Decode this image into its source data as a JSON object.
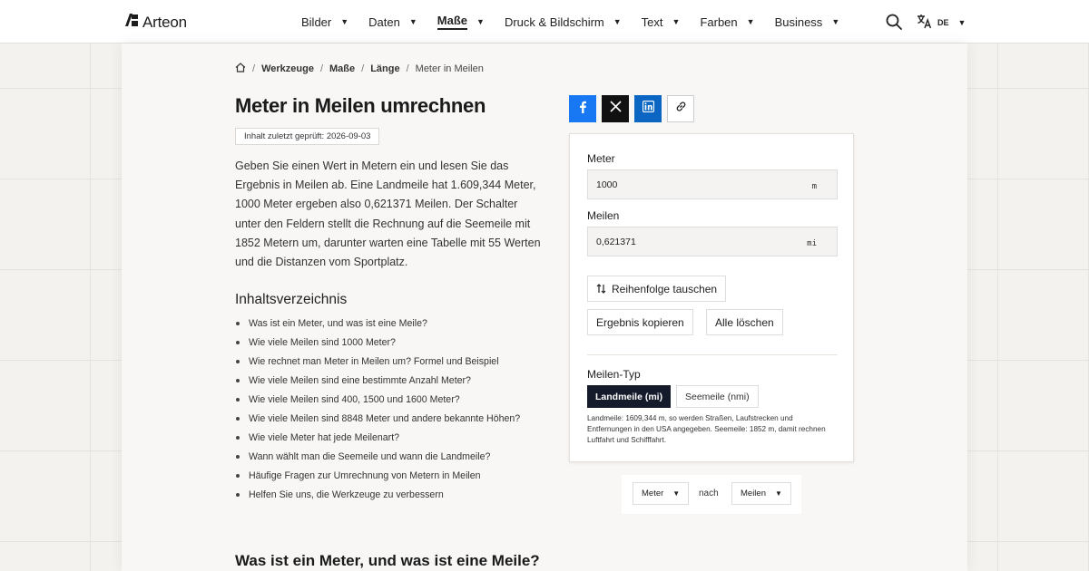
{
  "brand": {
    "name": "Arteon"
  },
  "nav": {
    "items": [
      {
        "label": "Bilder",
        "active": false
      },
      {
        "label": "Daten",
        "active": false
      },
      {
        "label": "Maße",
        "active": true
      },
      {
        "label": "Druck & Bildschirm",
        "active": false
      },
      {
        "label": "Text",
        "active": false
      },
      {
        "label": "Farben",
        "active": false
      },
      {
        "label": "Business",
        "active": false
      }
    ],
    "language": "DE",
    "icons": {
      "search": "search-icon",
      "language": "translate-icon",
      "caret": "caret-down-icon"
    }
  },
  "breadcrumb": {
    "home_icon": "home-icon",
    "items": [
      "Werkzeuge",
      "Maße",
      "Länge"
    ],
    "current": "Meter in Meilen"
  },
  "page": {
    "title": "Meter in Meilen umrechnen",
    "checked": "Inhalt zuletzt geprüft: 2026-09-03",
    "intro": "Geben Sie einen Wert in Metern ein und lesen Sie das Ergebnis in Meilen ab. Eine Landmeile hat 1.609,344 Meter, 1000 Meter ergeben also 0,621371 Meilen. Der Schalter unter den Feldern stellt die Rechnung auf die Seemeile mit 1852 Metern um, darunter warten eine Tabelle mit 55 Werten und die Distanzen vom Sportplatz.",
    "toc_title": "Inhaltsverzeichnis",
    "toc": [
      "Was ist ein Meter, und was ist eine Meile?",
      "Wie viele Meilen sind 1000 Meter?",
      "Wie rechnet man Meter in Meilen um? Formel und Beispiel",
      "Wie viele Meilen sind eine bestimmte Anzahl Meter?",
      "Wie viele Meilen sind 400, 1500 und 1600 Meter?",
      "Wie viele Meilen sind 8848 Meter und andere bekannte Höhen?",
      "Wie viele Meter hat jede Meilenart?",
      "Wann wählt man die Seemeile und wann die Landmeile?",
      "Häufige Fragen zur Umrechnung von Metern in Meilen",
      "Helfen Sie uns, die Werkzeuge zu verbessern"
    ],
    "section_heading": "Was ist ein Meter, und was ist eine Meile?"
  },
  "share": {
    "icons": [
      "facebook-icon",
      "x-icon",
      "linkedin-icon",
      "link-icon"
    ],
    "colors": {
      "facebook": "#1877f2",
      "x": "#111111",
      "linkedin": "#0a66c2"
    }
  },
  "converter": {
    "from": {
      "label": "Meter",
      "value": "1000",
      "unit": "m"
    },
    "to": {
      "label": "Meilen",
      "value": "0,621371",
      "unit": "mi"
    },
    "swap_label": "Reihenfolge tauschen",
    "swap_icon": "swap-vertical-icon",
    "copy_label": "Ergebnis kopieren",
    "clear_label": "Alle löschen",
    "type_label": "Meilen-Typ",
    "type_options": [
      "Landmeile (mi)",
      "Seemeile (nmi)"
    ],
    "type_selected": "Landmeile (mi)",
    "type_note": "Landmeile: 1609,344 m, so werden Straßen, Laufstrecken und Entfernungen in den USA angegeben. Seemeile: 1852 m, damit rechnen Luftfahrt und Schifffahrt.",
    "accent_color": "#161b2c"
  },
  "direction": {
    "from": "Meter",
    "word": "nach",
    "to": "Meilen"
  }
}
